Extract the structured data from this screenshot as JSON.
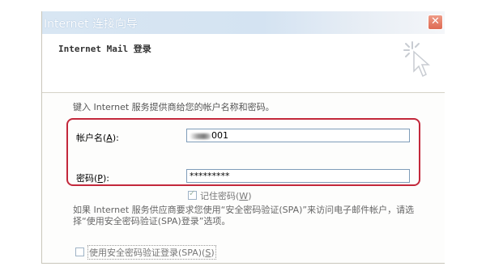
{
  "window": {
    "title": "Internet 连接向导",
    "close_glyph": "✕"
  },
  "header": {
    "title": "Internet Mail 登录",
    "icon": "wizard-sparkle-cursor-icon"
  },
  "body": {
    "intro": "键入 Internet 服务提供商给您的帐户名称和密码。",
    "account_label": "帐户名",
    "account_mnemonic": "A",
    "account_value": "001",
    "password_label": "密码",
    "password_mnemonic": "P",
    "password_value": "*********",
    "remember_label": "记住密码",
    "remember_mnemonic": "W",
    "remember_checked": true,
    "spa_para": "如果 Internet 服务供应商要求您使用“安全密码验证(SPA)”来访问电子邮件帐户，请选择“使用安全密码验证(SPA)登录”选项。",
    "spa_label": "使用安全密码验证登录(SPA)",
    "spa_mnemonic": "S",
    "spa_checked": false
  },
  "colors": {
    "highlight": "#c3283b",
    "titlebar": "#d4e3f2",
    "close": "#de6a52"
  }
}
